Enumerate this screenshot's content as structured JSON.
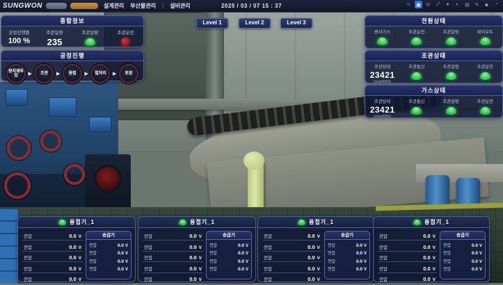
{
  "top_bar": {
    "logo": "SUNGWON",
    "nav": [
      {
        "label": "설계관리"
      },
      {
        "label": "부산물관리"
      },
      {
        "label": "설비관리"
      }
    ],
    "nav_separator": "|",
    "datetime": "2025 / 03 / 07 15 : 37",
    "icons": [
      {
        "name": "cursor-icon",
        "active": false
      },
      {
        "name": "select-tool-icon",
        "active": true
      },
      {
        "name": "refresh-icon",
        "active": false
      },
      {
        "name": "expand-icon",
        "active": false
      },
      {
        "name": "record-icon",
        "active": false
      },
      {
        "name": "brightness-icon",
        "active": false
      },
      {
        "name": "monitor-icon",
        "active": false
      },
      {
        "name": "annotate-icon",
        "active": false
      },
      {
        "name": "network-icon",
        "active": false
      },
      {
        "name": "timer-icon",
        "active": false
      }
    ]
  },
  "summary": {
    "title": "종합정보",
    "progress_label": "공정진행률",
    "progress_value": "100 %",
    "daily_label": "조관일량",
    "daily_value": "235",
    "alarm_label": "조관알람",
    "run_label": "조관운전"
  },
  "process": {
    "title": "공정진행",
    "steps": [
      "원자재투입",
      "조관",
      "용접",
      "열처리",
      "포장"
    ],
    "arrow": "▶"
  },
  "levels": [
    "Level 1",
    "Level 2",
    "Level 3"
  ],
  "status_panels": [
    {
      "title": "전원상태",
      "items": [
        {
          "label": "센서가스",
          "type": "lamp"
        },
        {
          "label": "조관운전",
          "type": "lamp"
        },
        {
          "label": "조관알람",
          "type": "lamp"
        },
        {
          "label": "파이로트",
          "type": "lamp"
        }
      ]
    },
    {
      "title": "조관상태",
      "items": [
        {
          "label": "조관상태",
          "type": "value",
          "value": "23421",
          "unit": "(mm/MIN)"
        },
        {
          "label": "조관통신",
          "type": "lamp"
        },
        {
          "label": "조관알람",
          "type": "lamp"
        },
        {
          "label": "조관운전",
          "type": "lamp"
        }
      ]
    },
    {
      "title": "가스상태",
      "items": [
        {
          "label": "조관상태",
          "type": "value",
          "value": "23421",
          "unit": "(mm/MIN)"
        },
        {
          "label": "조관통신",
          "type": "lamp"
        },
        {
          "label": "조관알람",
          "type": "lamp"
        },
        {
          "label": "조관운전",
          "type": "lamp"
        }
      ]
    }
  ],
  "welders": [
    {
      "title": "용접기_1",
      "rows": [
        {
          "label": "전압",
          "value": "0.0",
          "unit": "V"
        },
        {
          "label": "전압",
          "value": "0.0",
          "unit": "V"
        },
        {
          "label": "전압",
          "value": "0.0",
          "unit": "V"
        },
        {
          "label": "전압",
          "value": "0.0",
          "unit": "V"
        },
        {
          "label": "전압",
          "value": "0.0",
          "unit": "V"
        }
      ],
      "feeder": {
        "title": "송급기",
        "rows": [
          {
            "label": "전압",
            "value": "0.0",
            "unit": "V"
          },
          {
            "label": "전압",
            "value": "0.0",
            "unit": "V"
          },
          {
            "label": "전압",
            "value": "0.0",
            "unit": "V"
          },
          {
            "label": "전압",
            "value": "0.0",
            "unit": "V"
          }
        ]
      }
    },
    {
      "title": "용접기_1",
      "rows": [
        {
          "label": "전압",
          "value": "0.0",
          "unit": "V"
        },
        {
          "label": "전압",
          "value": "0.0",
          "unit": "V"
        },
        {
          "label": "전압",
          "value": "0.0",
          "unit": "V"
        },
        {
          "label": "전압",
          "value": "0.0",
          "unit": "V"
        },
        {
          "label": "전압",
          "value": "0.0",
          "unit": "V"
        }
      ],
      "feeder": {
        "title": "송급기",
        "rows": [
          {
            "label": "전압",
            "value": "0.0",
            "unit": "V"
          },
          {
            "label": "전압",
            "value": "0.0",
            "unit": "V"
          },
          {
            "label": "전압",
            "value": "0.0",
            "unit": "V"
          },
          {
            "label": "전압",
            "value": "0.0",
            "unit": "V"
          }
        ]
      }
    },
    {
      "title": "용접기_1",
      "rows": [
        {
          "label": "전압",
          "value": "0.0",
          "unit": "V"
        },
        {
          "label": "전압",
          "value": "0.0",
          "unit": "V"
        },
        {
          "label": "전압",
          "value": "0.0",
          "unit": "V"
        },
        {
          "label": "전압",
          "value": "0.0",
          "unit": "V"
        },
        {
          "label": "전압",
          "value": "0.0",
          "unit": "V"
        }
      ],
      "feeder": {
        "title": "송급기",
        "rows": [
          {
            "label": "전압",
            "value": "0.0",
            "unit": "V"
          },
          {
            "label": "전압",
            "value": "0.0",
            "unit": "V"
          },
          {
            "label": "전압",
            "value": "0.0",
            "unit": "V"
          },
          {
            "label": "전압",
            "value": "0.0",
            "unit": "V"
          }
        ]
      }
    },
    {
      "title": "용접기_1",
      "rows": [
        {
          "label": "전압",
          "value": "0.0",
          "unit": "V"
        },
        {
          "label": "전압",
          "value": "0.0",
          "unit": "V"
        },
        {
          "label": "전압",
          "value": "0.0",
          "unit": "V"
        },
        {
          "label": "전압",
          "value": "0.0",
          "unit": "V"
        },
        {
          "label": "전압",
          "value": "0.0",
          "unit": "V"
        }
      ],
      "feeder": {
        "title": "송급기",
        "rows": [
          {
            "label": "전압",
            "value": "0.0",
            "unit": "V"
          },
          {
            "label": "전압",
            "value": "0.0",
            "unit": "V"
          },
          {
            "label": "전압",
            "value": "0.0",
            "unit": "V"
          },
          {
            "label": "전압",
            "value": "0.0",
            "unit": "V"
          }
        ]
      }
    }
  ],
  "colors": {
    "accent_border": "#4c5fa8",
    "panel_bg": "#0f1834",
    "lamp_green": "#30ca4d",
    "lamp_red": "#a8191d",
    "level_button_bg": "#1c2650"
  }
}
